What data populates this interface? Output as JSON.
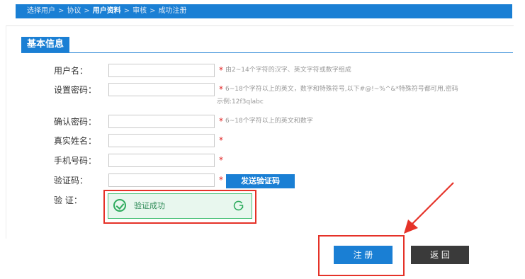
{
  "breadcrumb": {
    "steps": [
      "选择用户",
      "协议",
      "用户资料",
      "审核",
      "成功注册"
    ],
    "separator": ">",
    "current_index": 2
  },
  "section": {
    "title": "基本信息"
  },
  "form": {
    "username": {
      "label": "用户名：",
      "value": "",
      "required": "*",
      "hint": "由2~14个字符的汉字、英文字符或数字组成"
    },
    "password": {
      "label": "设置密码：",
      "value": "",
      "required": "*",
      "hint_line1": "6~18个字符以上的英文，数字和特殊符号,以下#@!~%^&*特殊符号都可用,密码",
      "hint_line2": "示例:12f3qlabc"
    },
    "confirm": {
      "label": "确认密码：",
      "value": "",
      "required": "*",
      "hint": "6~18个字符以上的英文和数字"
    },
    "realname": {
      "label": "真实姓名：",
      "value": "",
      "required": "*"
    },
    "phone": {
      "label": "手机号码：",
      "value": "",
      "required": "*"
    },
    "code": {
      "label": "验证码：",
      "value": "",
      "required": "*",
      "send_button": "发送验证码"
    },
    "verify": {
      "label": "验  证：",
      "status_text": "验证成功"
    }
  },
  "actions": {
    "register": "注 册",
    "back": "返 回"
  },
  "colors": {
    "accent": "#1a7fd4",
    "success": "#2eab5d",
    "highlight": "#e53228",
    "back_button": "#3a3a3a"
  }
}
